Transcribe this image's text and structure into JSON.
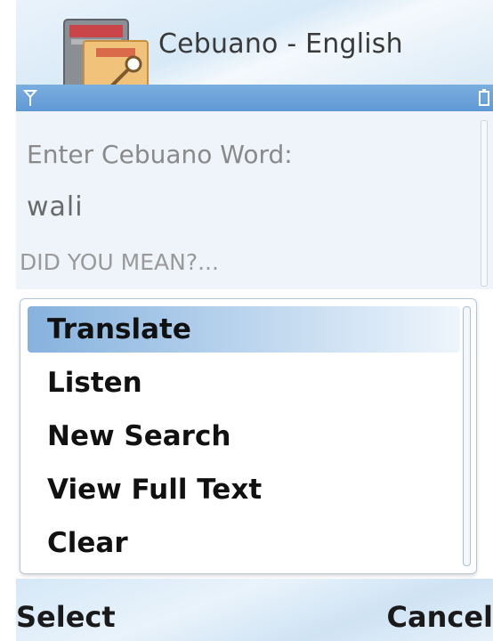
{
  "header": {
    "title": "Cebuano - English",
    "icon": "dictionary-app-icon"
  },
  "status_bar": {
    "signal_icon": "signal-icon",
    "battery_icon": "battery-icon"
  },
  "form": {
    "prompt": "Enter Cebuano Word:",
    "word": "wali",
    "suggestion_label": "DID YOU MEAN?..."
  },
  "menu": {
    "selected_index": 0,
    "items": [
      {
        "label": "Translate"
      },
      {
        "label": "Listen"
      },
      {
        "label": "New Search"
      },
      {
        "label": "View Full Text"
      },
      {
        "label": "Clear"
      }
    ]
  },
  "softkeys": {
    "left": "Select",
    "right": "Cancel"
  },
  "colors": {
    "accent": "#6aa3da",
    "selection": "#86b2de"
  }
}
